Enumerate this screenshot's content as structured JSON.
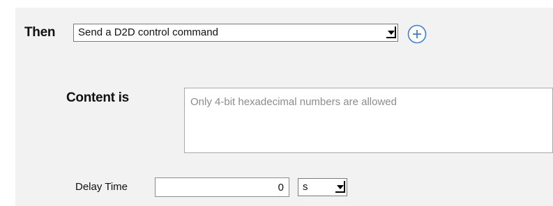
{
  "rule": {
    "then_label": "Then",
    "action_select": {
      "selected": "Send a D2D control command"
    },
    "add_action_icon": "plus-circle-icon",
    "content_label": "Content is",
    "content_field": {
      "value": "",
      "placeholder": "Only 4-bit hexadecimal numbers are allowed"
    },
    "delay": {
      "label": "Delay Time",
      "value": "0",
      "unit_selected": "s"
    }
  },
  "colors": {
    "panel_background": "#f2f2f2",
    "accent": "#3d7ddb"
  }
}
